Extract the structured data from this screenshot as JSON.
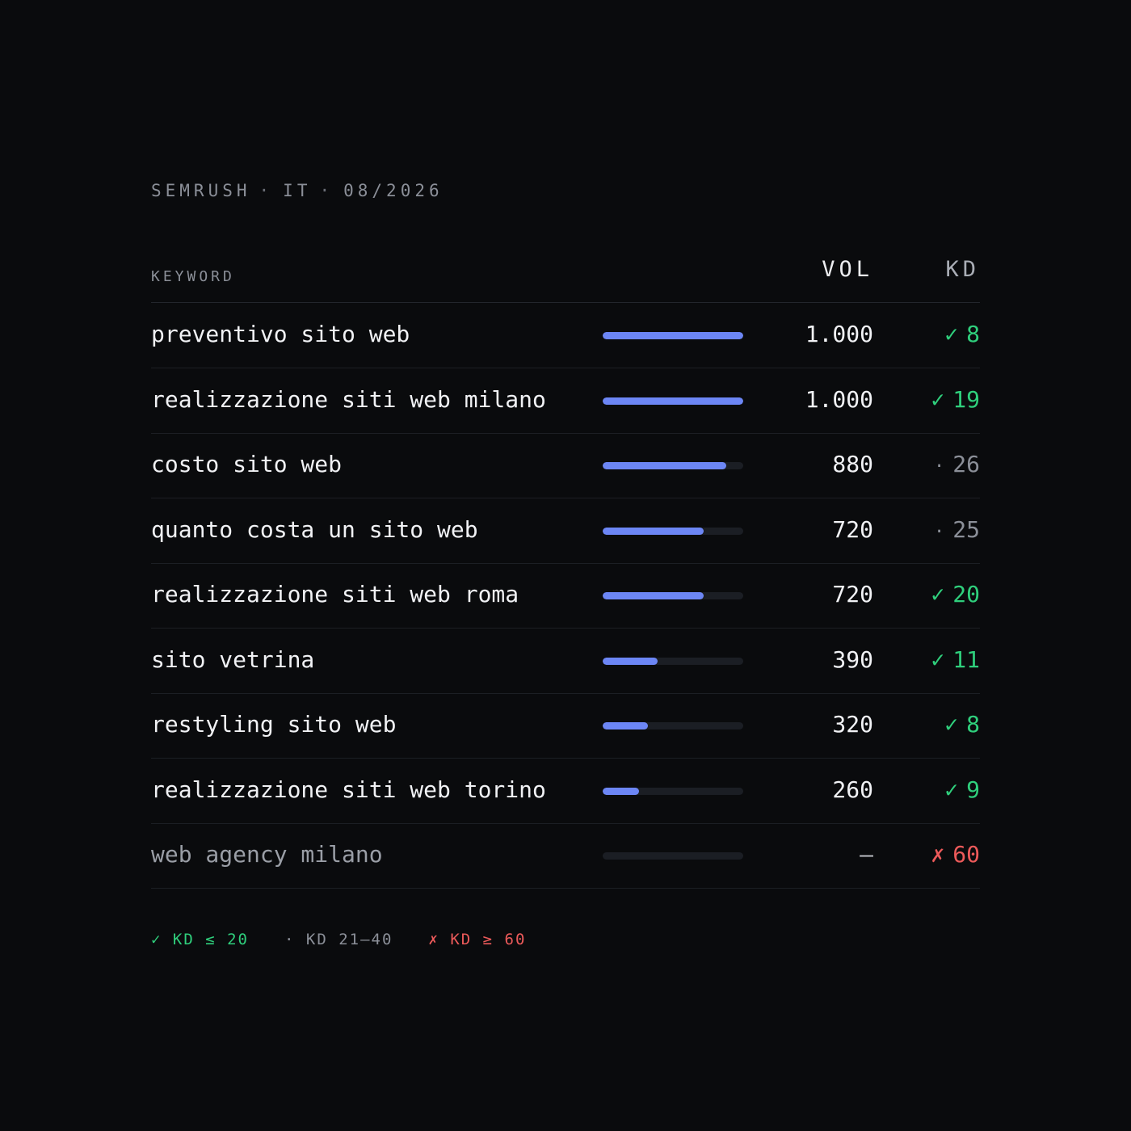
{
  "meta": {
    "source": "SEMRUSH",
    "country": "IT",
    "date": "08/2026",
    "separator": "·"
  },
  "header": {
    "keyword": "KEYWORD",
    "vol": "VOL",
    "kd": "KD"
  },
  "colors": {
    "bar": "#6c86f5",
    "easy": "#2fcf7c",
    "mid": "#8b8f98",
    "hard": "#ec5a5a"
  },
  "chart_data": {
    "type": "table",
    "max_volume": 1000,
    "rows": [
      {
        "keyword": "preventivo sito web",
        "volume": 1000,
        "volume_label": "1.000",
        "kd": 8,
        "kd_label": "8",
        "kd_mark": "✓",
        "status": "easy"
      },
      {
        "keyword": "realizzazione siti web milano",
        "volume": 1000,
        "volume_label": "1.000",
        "kd": 19,
        "kd_label": "19",
        "kd_mark": "✓",
        "status": "easy"
      },
      {
        "keyword": "costo sito web",
        "volume": 880,
        "volume_label": "880",
        "kd": 26,
        "kd_label": "26",
        "kd_mark": "·",
        "status": "mid"
      },
      {
        "keyword": "quanto costa un sito web",
        "volume": 720,
        "volume_label": "720",
        "kd": 25,
        "kd_label": "25",
        "kd_mark": "·",
        "status": "mid"
      },
      {
        "keyword": "realizzazione siti web roma",
        "volume": 720,
        "volume_label": "720",
        "kd": 20,
        "kd_label": "20",
        "kd_mark": "✓",
        "status": "easy"
      },
      {
        "keyword": "sito vetrina",
        "volume": 390,
        "volume_label": "390",
        "kd": 11,
        "kd_label": "11",
        "kd_mark": "✓",
        "status": "easy"
      },
      {
        "keyword": "restyling sito web",
        "volume": 320,
        "volume_label": "320",
        "kd": 8,
        "kd_label": "8",
        "kd_mark": "✓",
        "status": "easy"
      },
      {
        "keyword": "realizzazione siti web torino",
        "volume": 260,
        "volume_label": "260",
        "kd": 9,
        "kd_label": "9",
        "kd_mark": "✓",
        "status": "easy"
      },
      {
        "keyword": "web agency milano",
        "volume": null,
        "volume_label": "—",
        "kd": 60,
        "kd_label": "60",
        "kd_mark": "✗",
        "status": "hard"
      }
    ]
  },
  "legend": [
    {
      "mark": "✓",
      "label": "KD ≤ 20",
      "status": "easy"
    },
    {
      "mark": "·",
      "label": "KD 21–40",
      "status": "mid"
    },
    {
      "mark": "✗",
      "label": "KD ≥ 60",
      "status": "hard"
    }
  ]
}
